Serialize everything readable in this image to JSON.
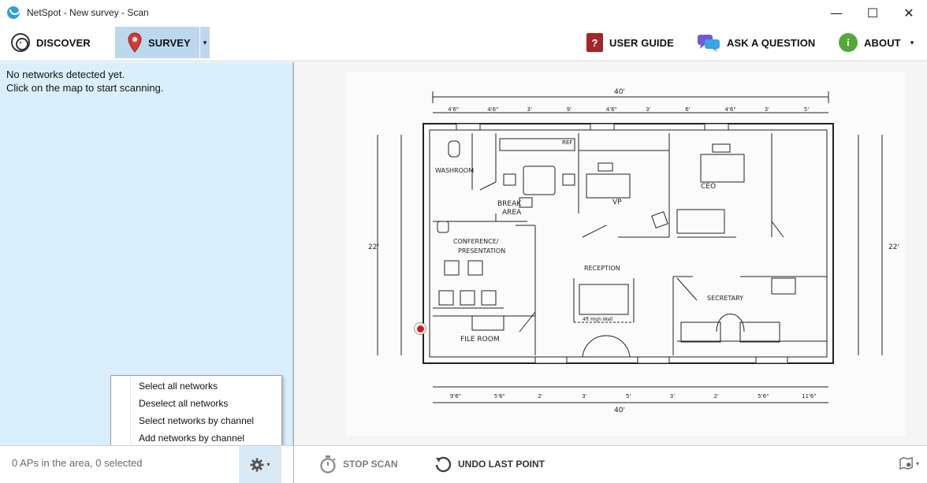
{
  "window": {
    "title": "NetSpot - New survey - Scan",
    "controls": {
      "minimize": "—",
      "maximize": "☐",
      "close": "✕"
    }
  },
  "toolbar": {
    "discover_label": "DISCOVER",
    "survey_label": "SURVEY",
    "survey_caret": "▾",
    "user_guide_label": "USER GUIDE",
    "user_guide_icon_glyph": "?",
    "ask_label": "ASK A QUESTION",
    "about_label": "ABOUT",
    "about_icon_glyph": "i",
    "about_caret": "▾",
    "selected_tab": "survey"
  },
  "left_panel": {
    "message_line1": "No networks detected yet.",
    "message_line2": "Click on the map to start scanning.",
    "ap_count": "0 APs in the area, 0 selected",
    "gear_caret": "▾"
  },
  "context_menu": {
    "items": [
      {
        "label": "Select all networks"
      },
      {
        "label": "Deselect all networks"
      },
      {
        "label": "Select networks by channel"
      },
      {
        "label": "Add networks by channel"
      }
    ]
  },
  "floorplan": {
    "overall_width": "40'",
    "overall_width_bottom": "40'",
    "height_left": "22'",
    "height_right": "22'",
    "rooms": {
      "washroom": "WASHROOM",
      "break_area_1": "BREAK",
      "break_area_2": "AREA",
      "vp": "VP",
      "ceo": "CEO",
      "conference_1": "CONFERENCE/",
      "conference_2": "PRESENTATION",
      "reception": "RECEPTION",
      "wall_note": "4ft High Wall",
      "secretary": "SECRETARY",
      "file_room": "FILE ROOM",
      "ref": "REF"
    },
    "top_dims": [
      "4'6\"",
      "4'6\"",
      "3'",
      "9'",
      "4'6\"",
      "3'",
      "6'",
      "4'6\"",
      "3'",
      "5'"
    ],
    "bottom_dims": [
      "9'6\"",
      "5'6\"",
      "2'",
      "3'",
      "5'",
      "3'",
      "2'",
      "5'6\"",
      "11'6\""
    ]
  },
  "bottom_bar": {
    "stop_scan_label": "STOP SCAN",
    "undo_label": "UNDO LAST POINT",
    "map_options_caret": "▾"
  },
  "colors": {
    "left_panel_bg": "#d9f0fc",
    "selected_tab_bg": "#bcd8ef",
    "scan_point": "#e0141d",
    "user_guide_icon": "#a3262a",
    "about_icon": "#54a83a",
    "ask_icon": "#6b4fd0"
  }
}
